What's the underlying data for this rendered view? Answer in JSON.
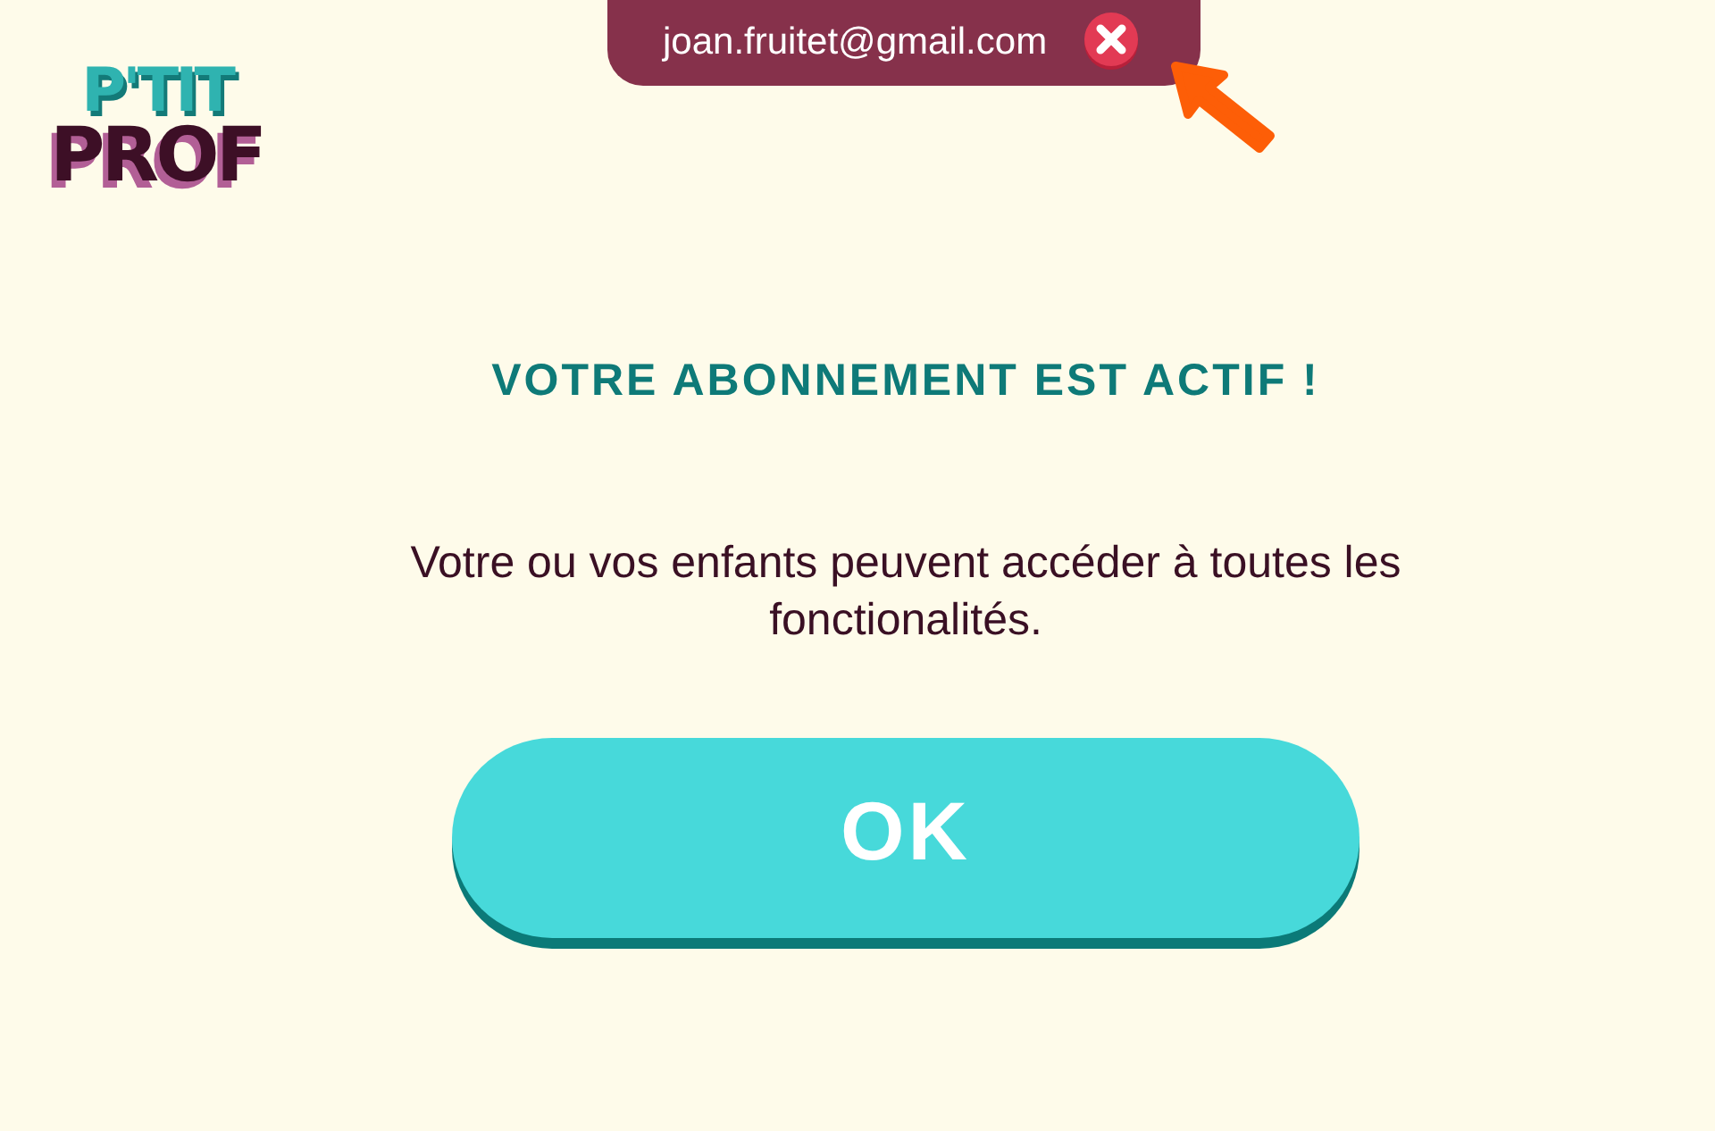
{
  "logo": {
    "line_1": "P'TIT",
    "line_2": "PROF"
  },
  "account_bar": {
    "email": "joan.fruitet@gmail.com"
  },
  "title": "VOTRE ABONNEMENT EST ACTIF !",
  "message": "Votre ou vos enfants peuvent accéder à toutes les fonctionalités.",
  "buttons": [
    "OK"
  ]
}
